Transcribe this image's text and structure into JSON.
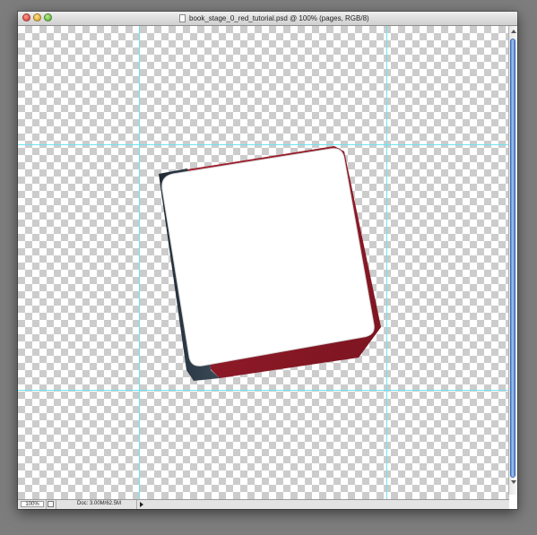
{
  "window": {
    "title": "book_stage_0_red_tutorial.psd @ 100% (pages, RGB/8)"
  },
  "status": {
    "zoom": "100%",
    "doc_info": "Doc: 3.00M/62.5M"
  },
  "icons": {
    "close": "close-button",
    "minimize": "minimize-button",
    "zoom": "zoom-button",
    "document": "document-icon",
    "status_menu": "triangle-right-icon"
  },
  "colors": {
    "book_cover_red": "#8e1a27",
    "book_spine_dark": "#2d3945",
    "guides": "#6fe3f0",
    "page": "#ffffff",
    "scroll_thumb": "#5b8fd8"
  }
}
